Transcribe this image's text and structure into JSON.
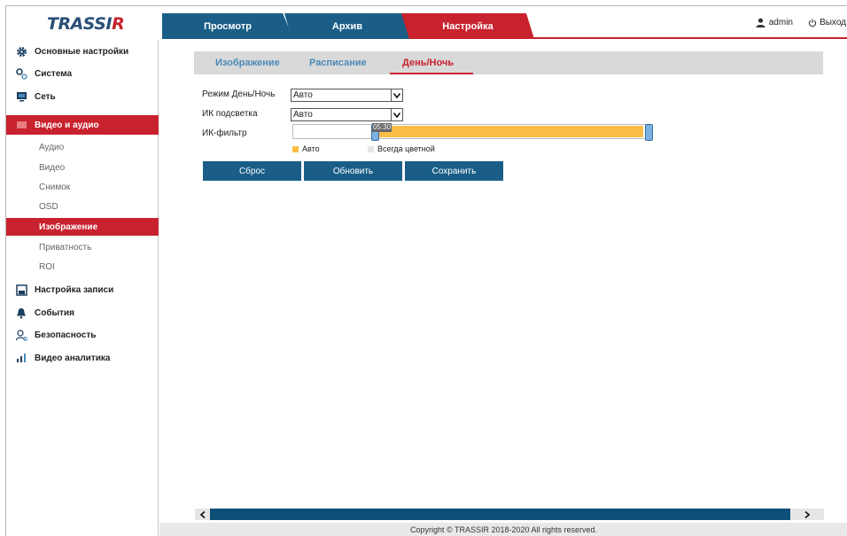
{
  "header": {
    "logo_main": "TRASSI",
    "logo_accent": "R",
    "tabs": [
      {
        "label": "Просмотр"
      },
      {
        "label": "Архив"
      },
      {
        "label": "Настройка"
      }
    ],
    "user_label": "admin",
    "logout_label": "Выход"
  },
  "sidebar": {
    "items": [
      {
        "label": "Основные настройки",
        "icon": "gear-icon"
      },
      {
        "label": "Система",
        "icon": "gears-icon"
      },
      {
        "label": "Сеть",
        "icon": "network-icon"
      },
      {
        "label": "Видео и аудио",
        "icon": "video-icon"
      },
      {
        "label": "Настройка записи",
        "icon": "storage-icon"
      },
      {
        "label": "События",
        "icon": "bell-icon"
      },
      {
        "label": "Безопасность",
        "icon": "user-security-icon"
      },
      {
        "label": "Видео аналитика",
        "icon": "chart-icon"
      }
    ],
    "sub_items": [
      {
        "label": "Аудио"
      },
      {
        "label": "Видео"
      },
      {
        "label": "Снимок"
      },
      {
        "label": "OSD"
      },
      {
        "label": "Изображение"
      },
      {
        "label": "Приватность"
      },
      {
        "label": "ROI"
      }
    ]
  },
  "main": {
    "subtabs": [
      {
        "label": "Изображение"
      },
      {
        "label": "Расписание"
      },
      {
        "label": "День/Ночь"
      }
    ],
    "fields": {
      "daynight_label": "Режим День/Ночь",
      "daynight_value": "Авто",
      "ir_label": "ИК подсветка",
      "ir_value": "Авто",
      "ircut_label": "ИК-фильтр",
      "ircut_time": "05:30"
    },
    "legend": {
      "auto_label": "Авто",
      "always_color_label": "Всегда цветной"
    },
    "buttons": {
      "reset": "Сброс",
      "refresh": "Обновить",
      "save": "Сохранить"
    }
  },
  "footer": {
    "copyright": "Copyright © TRASSIR 2018-2020 All rights reserved."
  },
  "colors": {
    "brand_blue": "#1a5e87",
    "brand_red": "#c8222e",
    "auto_fill": "#fbbd47",
    "always_color": "#e6e6e6"
  }
}
